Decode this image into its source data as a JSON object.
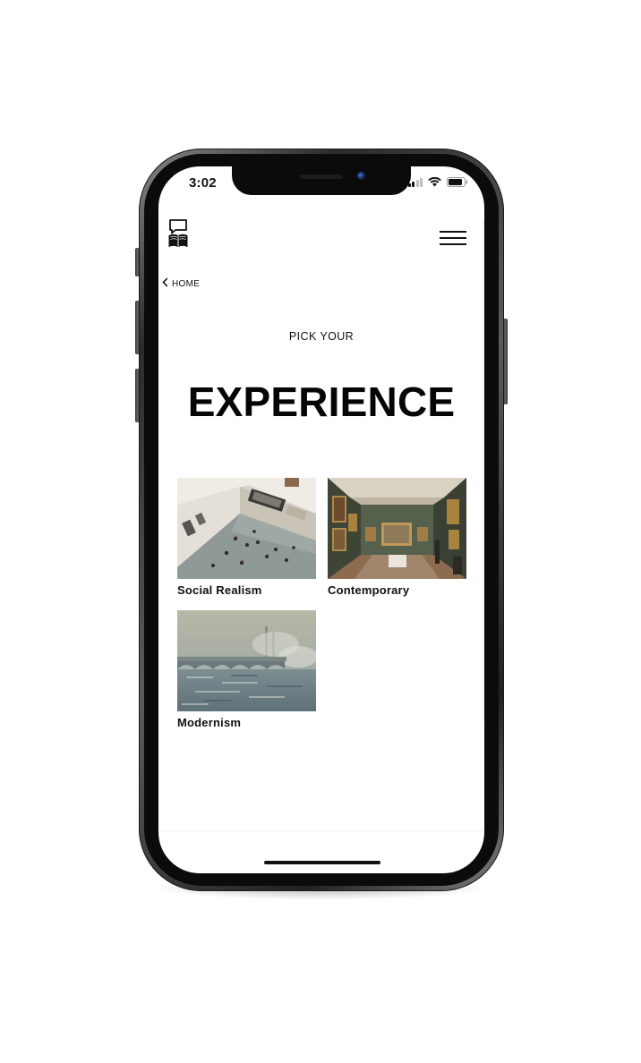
{
  "status_bar": {
    "time": "3:02",
    "signal_icon": "cellular-signal-icon",
    "wifi_icon": "wifi-icon",
    "battery_icon": "battery-icon"
  },
  "header": {
    "logo_icon": "book-speech-bubble-logo-icon",
    "menu_icon": "hamburger-menu-icon"
  },
  "nav": {
    "back_label": "HOME",
    "back_icon": "chevron-left-icon"
  },
  "page": {
    "subtitle": "PICK YOUR",
    "title": "EXPERIENCE"
  },
  "experiences": [
    {
      "label": "Social Realism",
      "image": "museum-gallery-overhead-photo"
    },
    {
      "label": "Contemporary",
      "image": "classical-gallery-interior-photo"
    },
    {
      "label": "Modernism",
      "image": "impressionist-bridge-painting"
    }
  ],
  "colors": {
    "text": "#111111",
    "background": "#ffffff",
    "frame": "#2b2b2b"
  }
}
